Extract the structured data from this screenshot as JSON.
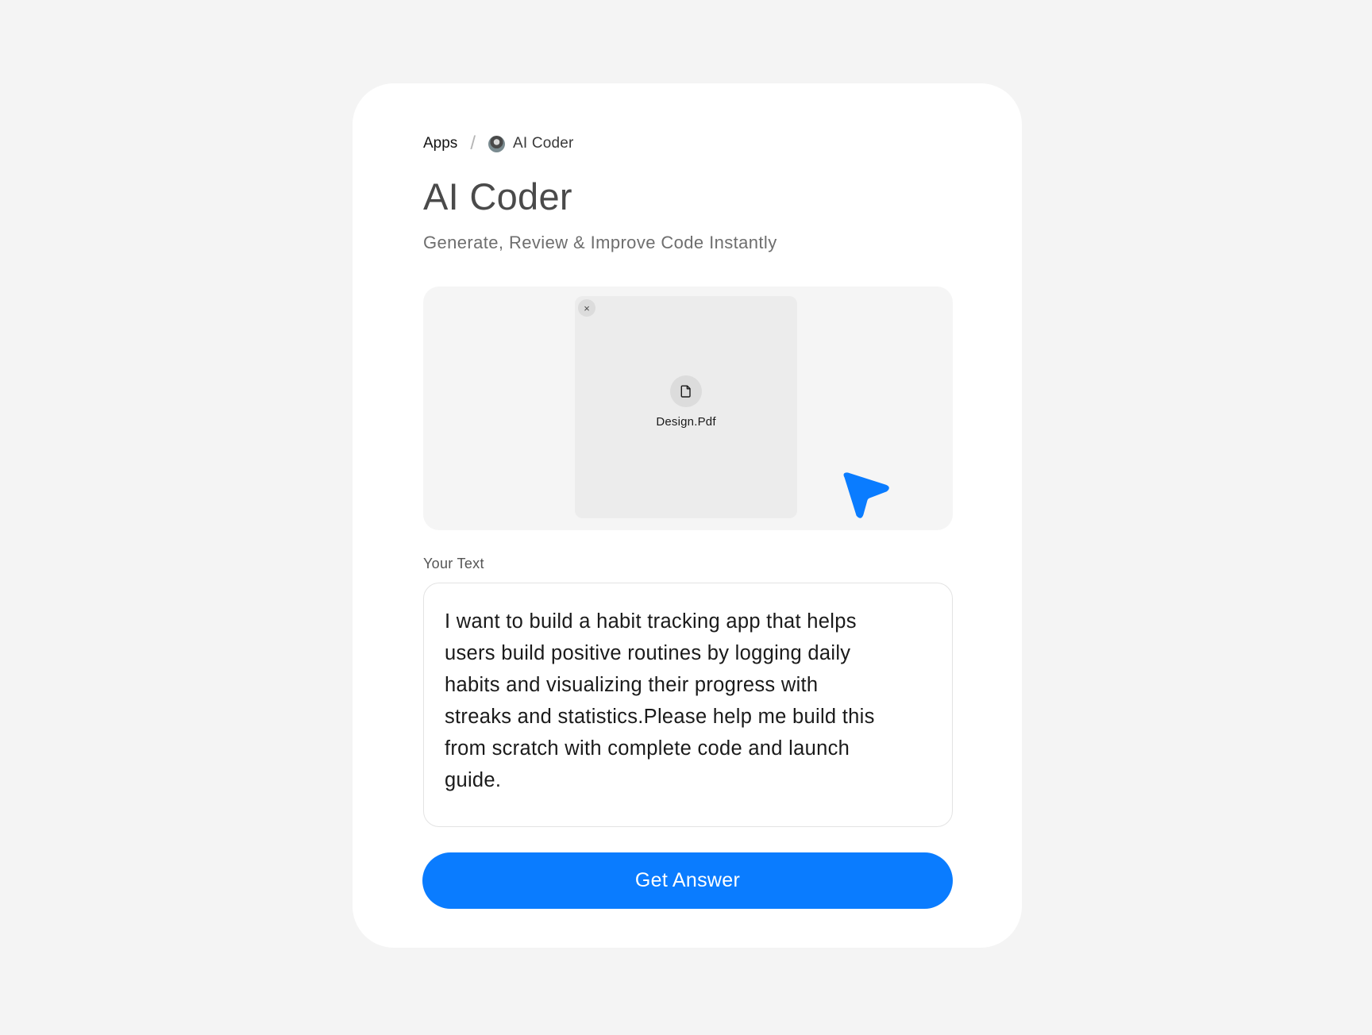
{
  "breadcrumb": {
    "root": "Apps",
    "separator": "/",
    "current": "AI Coder"
  },
  "header": {
    "title": "AI Coder",
    "subtitle": "Generate, Review & Improve Code Instantly"
  },
  "upload": {
    "remove_symbol": "×",
    "file_icon": "file-icon",
    "file_name": "Design.Pdf"
  },
  "input": {
    "label": "Your Text",
    "value": "I want to build a habit tracking app that helps\nusers build positive routines by logging daily\nhabits and visualizing their progress with\nstreaks and statistics.Please help me build this\nfrom scratch with complete code and launch\nguide."
  },
  "action": {
    "button_label": "Get Answer"
  },
  "colors": {
    "accent": "#0a7cff",
    "background": "#f4f4f4",
    "card": "#ffffff"
  }
}
